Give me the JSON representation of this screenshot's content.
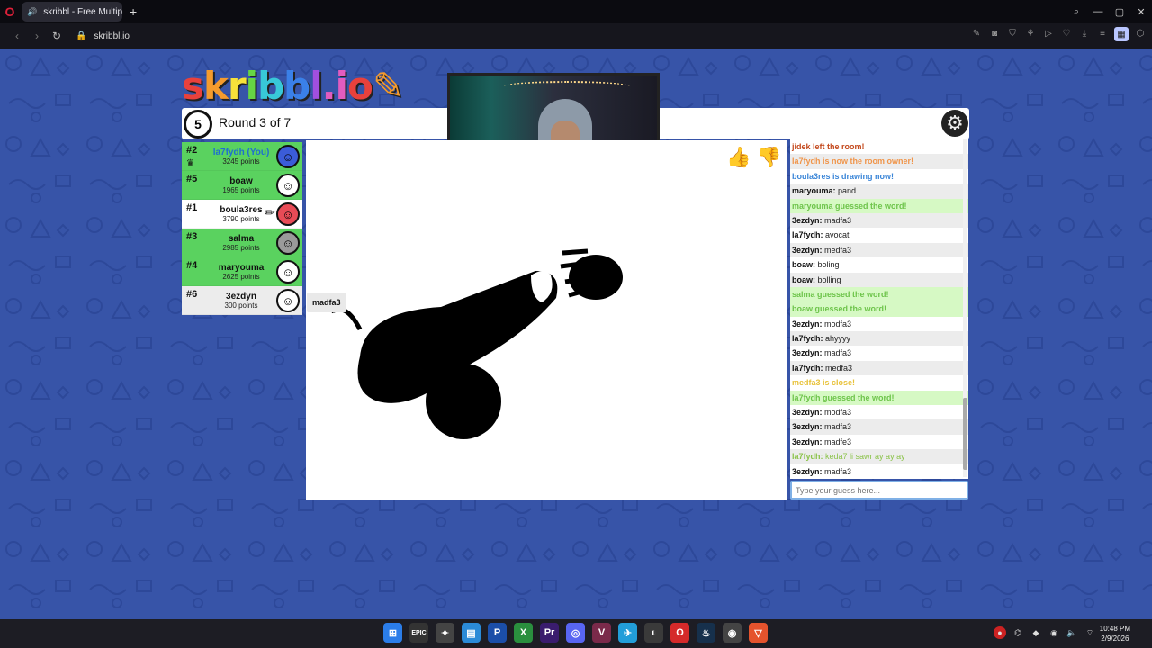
{
  "browser": {
    "tab_title": "skribbl - Free Multiplayer",
    "url": "skribbl.io",
    "new_tab": "+"
  },
  "game": {
    "logo": "skribbl.io",
    "clock_value": "5",
    "round_text": "Round 3 of 7",
    "drawer_word_bubble": "madfa3"
  },
  "players": [
    {
      "rank": "#2",
      "name": "la7fydh (You)",
      "points": "3245 points",
      "state": "guessed",
      "me": true,
      "avatar_color": "#3b5cd8",
      "crown": true
    },
    {
      "rank": "#5",
      "name": "boaw",
      "points": "1965 points",
      "state": "guessed",
      "avatar_color": "#ffffff"
    },
    {
      "rank": "#1",
      "name": "boula3res",
      "points": "3790 points",
      "state": "drawing",
      "avatar_color": "#e84b56",
      "drawing": true
    },
    {
      "rank": "#3",
      "name": "salma",
      "points": "2985 points",
      "state": "guessed",
      "avatar_color": "#9a9a9a"
    },
    {
      "rank": "#4",
      "name": "maryouma",
      "points": "2625 points",
      "state": "guessed",
      "avatar_color": "#ffffff"
    },
    {
      "rank": "#6",
      "name": "3ezdyn",
      "points": "300 points",
      "state": "plain",
      "avatar_color": "#ffffff"
    }
  ],
  "chat": [
    {
      "type": "sys-red",
      "text": "jidek left the room!"
    },
    {
      "type": "sys-orange",
      "text": "la7fydh is now the room owner!"
    },
    {
      "type": "sys-blue",
      "text": "boula3res is drawing now!"
    },
    {
      "type": "msg",
      "who": "maryouma:",
      "text": "pand"
    },
    {
      "type": "sys-green",
      "text": "maryouma guessed the word!"
    },
    {
      "type": "msg",
      "who": "3ezdyn:",
      "text": "madfa3"
    },
    {
      "type": "msg",
      "who": "la7fydh:",
      "text": "avocat"
    },
    {
      "type": "msg",
      "who": "3ezdyn:",
      "text": "medfa3"
    },
    {
      "type": "msg",
      "who": "boaw:",
      "text": "boling"
    },
    {
      "type": "msg",
      "who": "boaw:",
      "text": "bolling"
    },
    {
      "type": "sys-green",
      "text": "salma guessed the word!"
    },
    {
      "type": "sys-green",
      "text": "boaw guessed the word!"
    },
    {
      "type": "msg",
      "who": "3ezdyn:",
      "text": "modfa3"
    },
    {
      "type": "msg",
      "who": "la7fydh:",
      "text": "ahyyyy"
    },
    {
      "type": "msg",
      "who": "3ezdyn:",
      "text": "madfa3"
    },
    {
      "type": "msg",
      "who": "la7fydh:",
      "text": "medfa3"
    },
    {
      "type": "sys-yellow",
      "text": "medfa3 is close!"
    },
    {
      "type": "sys-green",
      "text": "la7fydh guessed the word!"
    },
    {
      "type": "msg",
      "who": "3ezdyn:",
      "text": "modfa3"
    },
    {
      "type": "msg",
      "who": "3ezdyn:",
      "text": "madfa3"
    },
    {
      "type": "msg",
      "who": "3ezdyn:",
      "text": "madfe3"
    },
    {
      "type": "owner",
      "who": "la7fydh:",
      "text": "keda7 li sawr ay ay ay"
    },
    {
      "type": "msg",
      "who": "3ezdyn:",
      "text": "madfa3"
    }
  ],
  "guess": {
    "placeholder": "Type your guess here..."
  },
  "taskbar": {
    "apps": [
      "⊞",
      "EPIC",
      "✦",
      "▤",
      "P",
      "X",
      "Pr",
      "◎",
      "V",
      "✈",
      "◐",
      "O",
      "♨",
      "◉",
      "▽"
    ],
    "time": "10:48 PM",
    "date": "2/9/2026"
  },
  "colors": {
    "page_bg": "#3754a8",
    "guessed": "#5ad25f",
    "accent_blue": "#1e6fd0"
  }
}
